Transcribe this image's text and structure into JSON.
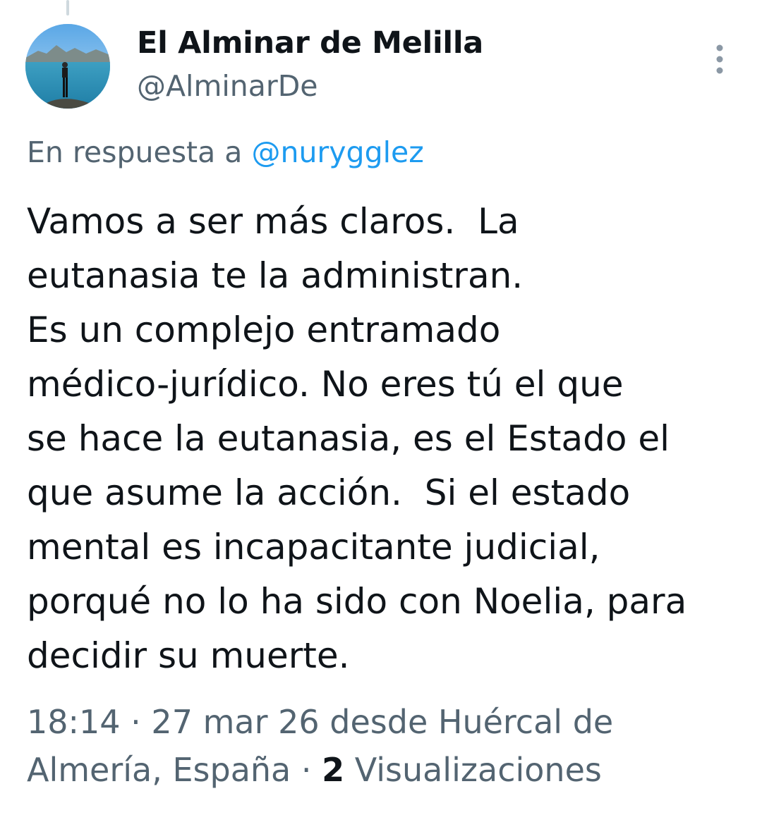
{
  "author": {
    "display_name": "El Alminar de Melilla",
    "handle": "@AlminarDe"
  },
  "reply": {
    "prefix": "En respuesta a ",
    "mention": "@nurygglez"
  },
  "tweet": {
    "text_lines": [
      "Vamos a ser más claros.  La",
      "eutanasia te la administran.",
      "Es un complejo entramado",
      "médico-jurídico. No eres tú el que",
      "se hace la eutanasia, es el Estado el",
      "que asume la acción.  Si el estado",
      "mental es incapacitante judicial,",
      "porqué no lo ha sido con Noelia, para",
      "decidir su muerte."
    ]
  },
  "meta": {
    "line1": "18:14 · 27 mar 26 desde Huércal de",
    "line2_prefix": "Almería, España · ",
    "views_count": "2",
    "views_label": " Visualizaciones"
  },
  "icons": {
    "more": "more-vertical-icon",
    "avatar": "avatar-image"
  },
  "colors": {
    "text": "#0f1419",
    "secondary": "#536471",
    "link": "#1d9bf0"
  }
}
